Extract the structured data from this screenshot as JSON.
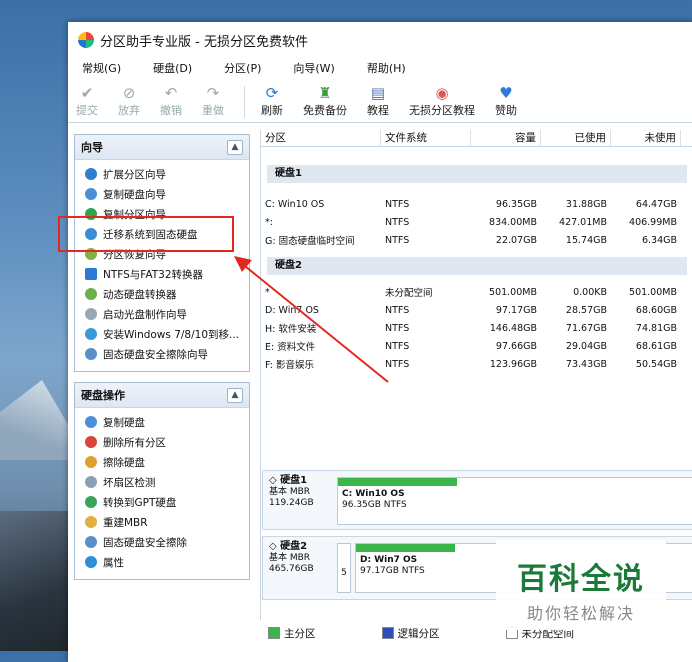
{
  "window": {
    "title": "分区助手专业版 - 无损分区免费软件"
  },
  "menu": [
    "常规(G)",
    "硬盘(D)",
    "分区(P)",
    "向导(W)",
    "帮助(H)"
  ],
  "toolbar": [
    {
      "label": "提交",
      "icon": "check-icon",
      "disabled": true
    },
    {
      "label": "放弃",
      "icon": "discard-icon",
      "disabled": true
    },
    {
      "label": "撤销",
      "icon": "undo-icon",
      "disabled": true
    },
    {
      "label": "重做",
      "icon": "redo-icon",
      "disabled": true
    },
    {
      "label": "刷新",
      "icon": "refresh-icon",
      "disabled": false
    },
    {
      "label": "免费备份",
      "icon": "backup-icon",
      "disabled": false
    },
    {
      "label": "教程",
      "icon": "tutorial-icon",
      "disabled": false
    },
    {
      "label": "无损分区教程",
      "icon": "tutorial-video-icon",
      "disabled": false
    },
    {
      "label": "赞助",
      "icon": "heart-icon",
      "disabled": false
    }
  ],
  "wizard_panel": {
    "title": "向导",
    "items": [
      "扩展分区向导",
      "复制硬盘向导",
      "复制分区向导",
      "迁移系统到固态硬盘",
      "分区恢复向导",
      "NTFS与FAT32转换器",
      "动态硬盘转换器",
      "启动光盘制作向导",
      "安装Windows 7/8/10到移...",
      "固态硬盘安全擦除向导"
    ]
  },
  "disk_panel": {
    "title": "硬盘操作",
    "items": [
      "复制硬盘",
      "删除所有分区",
      "擦除硬盘",
      "坏扇区检测",
      "转换到GPT硬盘",
      "重建MBR",
      "固态硬盘安全擦除",
      "属性"
    ]
  },
  "table": {
    "headers": [
      "分区",
      "文件系统",
      "容量",
      "已使用",
      "未使用"
    ],
    "groups": [
      {
        "name": "硬盘1",
        "rows": [
          [
            "C: Win10 OS",
            "NTFS",
            "96.35GB",
            "31.88GB",
            "64.47GB"
          ],
          [
            "*:",
            "NTFS",
            "834.00MB",
            "427.01MB",
            "406.99MB"
          ],
          [
            "G: 固态硬盘临时空间",
            "NTFS",
            "22.07GB",
            "15.74GB",
            "6.34GB"
          ]
        ]
      },
      {
        "name": "硬盘2",
        "rows": [
          [
            "*",
            "未分配空间",
            "501.00MB",
            "0.00KB",
            "501.00MB"
          ],
          [
            "D: Win7 OS",
            "NTFS",
            "97.17GB",
            "28.57GB",
            "68.60GB"
          ],
          [
            "H: 软件安装",
            "NTFS",
            "146.48GB",
            "71.67GB",
            "74.81GB"
          ],
          [
            "E: 资料文件",
            "NTFS",
            "97.66GB",
            "29.04GB",
            "68.61GB"
          ],
          [
            "F: 影音娱乐",
            "NTFS",
            "123.96GB",
            "73.43GB",
            "50.54GB"
          ]
        ]
      }
    ]
  },
  "disk_map": [
    {
      "name": "硬盘1",
      "type": "基本 MBR",
      "size": "119.24GB",
      "part_name": "C: Win10 OS",
      "part_detail": "96.35GB NTFS",
      "used_fraction": 0.33
    },
    {
      "name": "硬盘2",
      "type": "基本 MBR",
      "size": "465.76GB",
      "small": "5",
      "part_name": "D: Win7 OS",
      "part_detail": "97.17GB NTFS",
      "used_fraction": 0.29
    }
  ],
  "legend": [
    "主分区",
    "逻辑分区",
    "未分配空间"
  ],
  "watermark": {
    "title": "百科全说",
    "subtitle": "助你轻松解决"
  },
  "colors": {
    "highlight": "#e2281f",
    "primary": "#39b54a",
    "logical": "#2b4fb8"
  }
}
